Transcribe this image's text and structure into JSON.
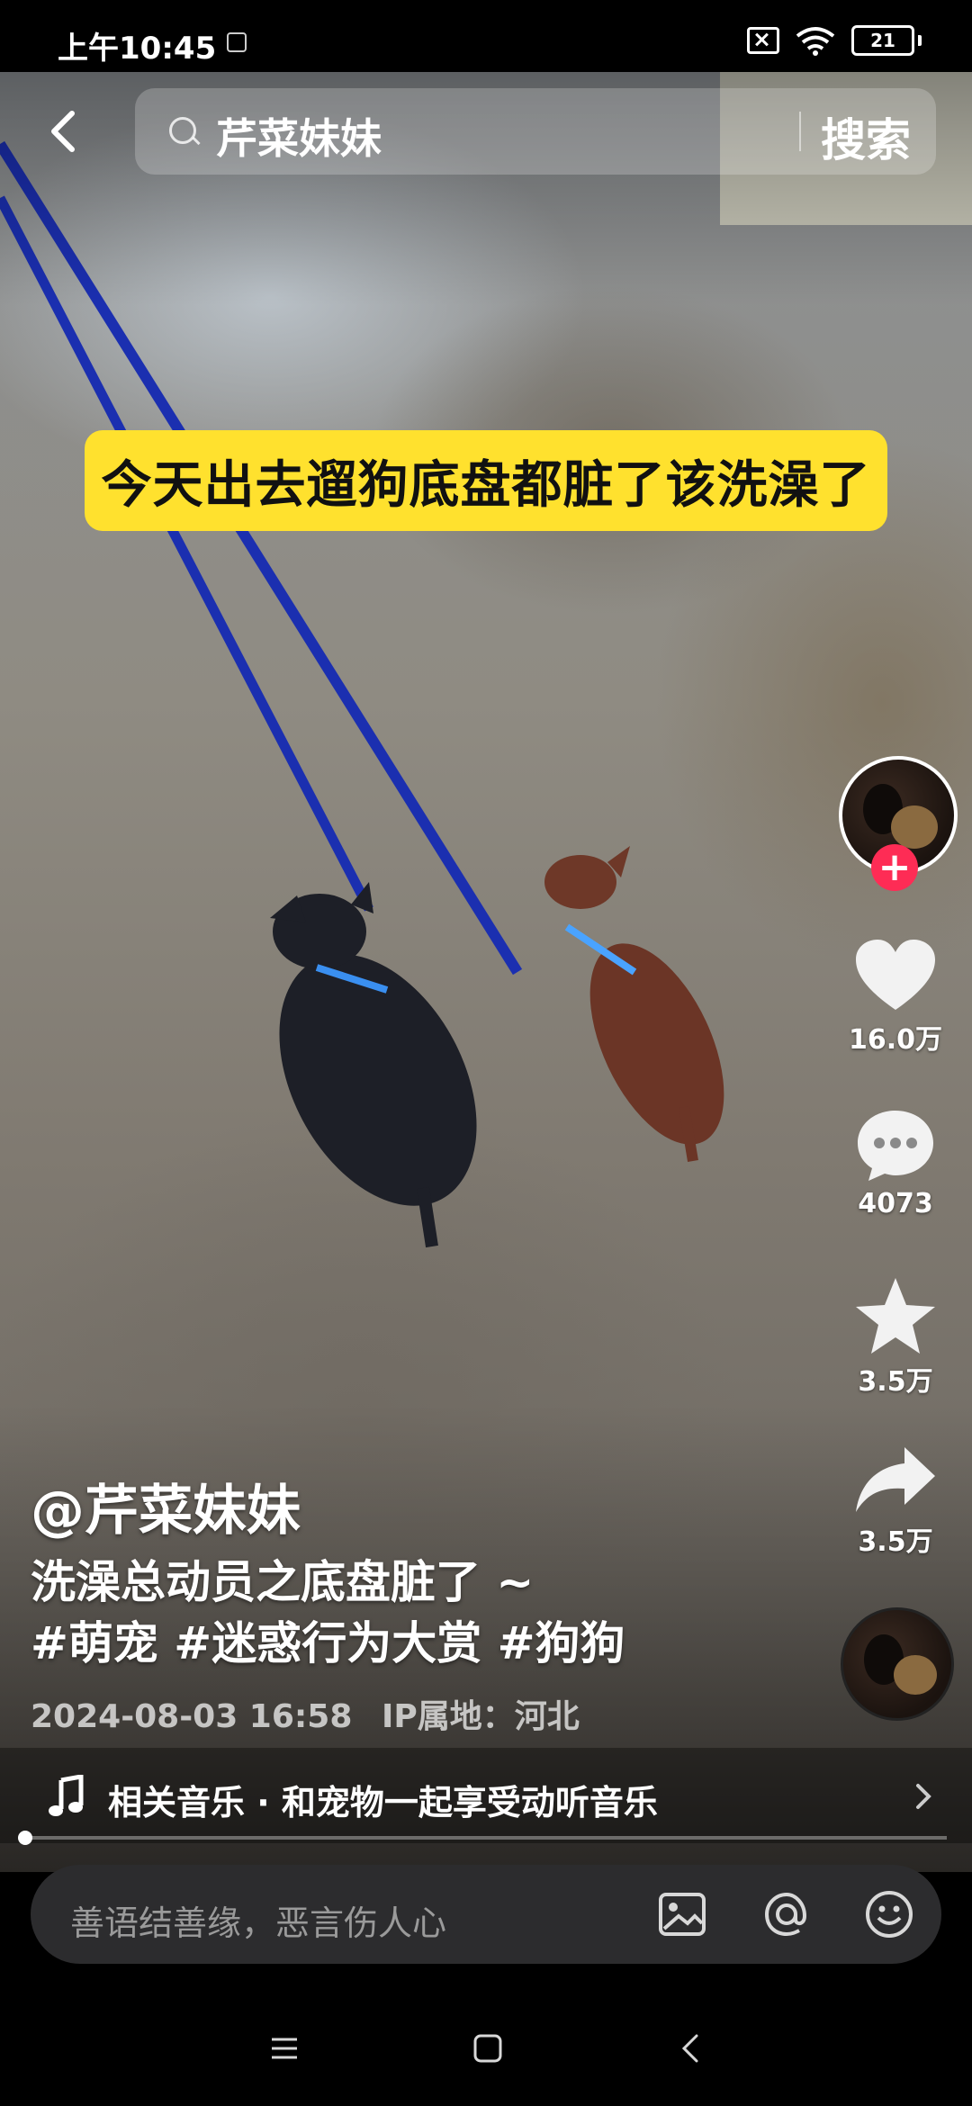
{
  "status_bar": {
    "time": "上午10:45",
    "battery": "21"
  },
  "search": {
    "query": "芹菜妹妹",
    "button": "搜索"
  },
  "video": {
    "caption": "今天出去遛狗底盘都脏了该洗澡了"
  },
  "actions": {
    "likes": "16.0万",
    "comments": "4073",
    "favorites": "3.5万",
    "shares": "3.5万"
  },
  "post": {
    "author": "@芹菜妹妹",
    "description_line1": "洗澡总动员之底盘脏了 ~",
    "description_line2": "#萌宠 #迷惑行为大赏 #狗狗",
    "date": "2024-08-03 16:58",
    "location": "IP属地：河北"
  },
  "music": {
    "text": "相关音乐 · 和宠物一起享受动听音乐"
  },
  "playback": {
    "progress": 0.0
  },
  "comment": {
    "placeholder": "善语结善缘，恶言伤人心"
  },
  "colors": {
    "caption_bg": "#ffe12e",
    "follow": "#fe2c55",
    "leash": "#1b2fb0"
  }
}
